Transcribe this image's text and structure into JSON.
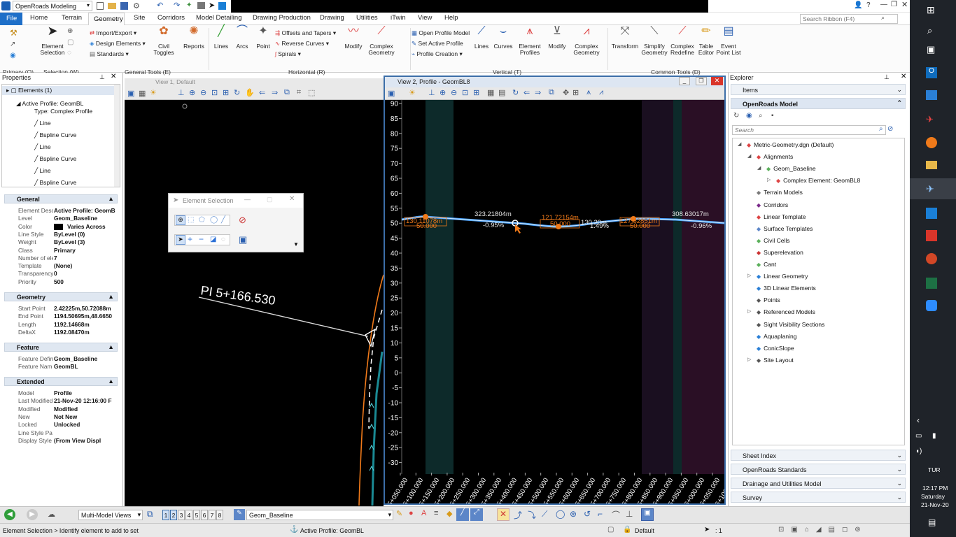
{
  "app": {
    "title_value": "OpenRoads Modeling",
    "search_placeholder": "Search Ribbon (F4)"
  },
  "tabs": [
    "File",
    "Home",
    "Terrain",
    "Geometry",
    "Site",
    "Corridors",
    "Model Detailing",
    "Drawing Production",
    "Drawing",
    "Utilities",
    "iTwin",
    "View",
    "Help"
  ],
  "ribbon": {
    "element_selection": "Element\nSelection",
    "selection_group": "Selection (W)",
    "primary_group": "Primary (Q)",
    "import_export": "Import/Export",
    "design_elements": "Design Elements",
    "standards": "Standards",
    "civil_toggles": "Civil\nToggles",
    "reports": "Reports",
    "general_tools_group": "General Tools (E)",
    "lines": "Lines",
    "arcs": "Arcs",
    "point": "Point",
    "offsets_tapers": "Offsets and Tapers",
    "reverse_curves": "Reverse Curves",
    "spirals": "Spirals",
    "modify": "Modify",
    "complex_geometry": "Complex\nGeometry",
    "horizontal_group": "Horizontal (R)",
    "open_profile_model": "Open Profile Model",
    "set_active_profile": "Set Active Profile",
    "profile_creation": "Profile Creation",
    "v_lines": "Lines",
    "v_curves": "Curves",
    "element_profiles": "Element\nProfiles",
    "v_modify": "Modify",
    "v_complex_geometry": "Complex\nGeometry",
    "vertical_group": "Vertical (T)",
    "transform": "Transform",
    "simplify_geometry": "Simplify\nGeometry",
    "complex_redefine": "Complex\nRedefine",
    "table_editor": "Table\nEditor",
    "event_point_list": "Event\nPoint List",
    "common_tools_group": "Common Tools (D)"
  },
  "properties": {
    "title": "Properties",
    "elements_count": "Elements (1)",
    "active_profile": "Active Profile: GeomBL",
    "type": "Type: Complex Profile",
    "children": [
      "Line",
      "Bspline Curve",
      "Line",
      "Bspline Curve",
      "Line",
      "Bspline Curve"
    ],
    "general_title": "General",
    "general_rows": [
      {
        "k": "Element Desc",
        "v": "Active Profile: GeomB"
      },
      {
        "k": "Level",
        "v": "Geom_Baseline"
      },
      {
        "k": "Color",
        "v": "Varies Across"
      },
      {
        "k": "Line Style",
        "v": "ByLevel (0)"
      },
      {
        "k": "Weight",
        "v": "ByLevel (3)"
      },
      {
        "k": "Class",
        "v": "Primary"
      },
      {
        "k": "Number of ele",
        "v": "7"
      },
      {
        "k": "Template",
        "v": "(None)"
      },
      {
        "k": "Transparency",
        "v": "0"
      },
      {
        "k": "Priority",
        "v": "500"
      }
    ],
    "geometry_title": "Geometry",
    "geometry_rows": [
      {
        "k": "Start Point",
        "v": "2.42225m,50.72088m"
      },
      {
        "k": "End Point",
        "v": "1194.50695m,48.6650"
      },
      {
        "k": "Length",
        "v": "1192.14668m"
      },
      {
        "k": "DeltaX",
        "v": "1192.08470m"
      }
    ],
    "feature_title": "Feature",
    "feature_rows": [
      {
        "k": "Feature Defin",
        "v": "Geom_Baseline"
      },
      {
        "k": "Feature Nam",
        "v": "GeomBL"
      }
    ],
    "extended_title": "Extended",
    "extended_rows": [
      {
        "k": "Model",
        "v": "Profile"
      },
      {
        "k": "Last Modified",
        "v": "21-Nov-20 12:16:00 F"
      },
      {
        "k": "Modified",
        "v": "Modified"
      },
      {
        "k": "New",
        "v": "Not New"
      },
      {
        "k": "Locked",
        "v": "Unlocked"
      },
      {
        "k": "Line Style Pa",
        "v": ""
      },
      {
        "k": "Display Style",
        "v": "(From View Displ"
      }
    ]
  },
  "view1": {
    "title": "View 1, Default",
    "pi_label": "PI 5+166.530"
  },
  "element_selection_dialog": {
    "title": "Element Selection"
  },
  "view2": {
    "title": "View 2, Profile - GeomBL8",
    "y_ticks": [
      "90",
      "85",
      "80",
      "75",
      "70",
      "65",
      "60",
      "55",
      "50",
      "45",
      "40",
      "35",
      "30",
      "25",
      "20",
      "15",
      "10",
      "5",
      "0",
      "-5",
      "-10",
      "-15",
      "-20",
      "-25",
      "-30"
    ],
    "x_ticks": [
      "5+050.000",
      "5+100.000",
      "5+150.000",
      "5+200.000",
      "5+250.000",
      "5+300.000",
      "5+350.000",
      "5+400.000",
      "5+450.000",
      "5+500.000",
      "5+550.000",
      "5+600.000",
      "5+650.000",
      "5+700.000",
      "5+750.000",
      "5+800.000",
      "5+850.000",
      "5+900.000",
      "5+950.000",
      "6+000.000",
      "6+050.000",
      "6+100.000"
    ],
    "annotations": {
      "len1": "323.21804m",
      "grade1": "-0.95%",
      "len2": "121.72154m",
      "len3": "130.20m",
      "grade2": "1.49%",
      "len4": "308.63017m",
      "grade3": "-0.96%",
      "curve_left_len": "130.11078m",
      "curve_left_k": "50.000",
      "curve_mid_k": "50.000",
      "curve_right_len": "127.52851m",
      "curve_right_k": "50.000"
    }
  },
  "explorer": {
    "title": "Explorer",
    "items": "Items",
    "model_title": "OpenRoads Model",
    "search_placeholder": "Search",
    "tree": [
      {
        "label": "Metric-Geometry.dgn (Default)",
        "level": 0
      },
      {
        "label": "Alignments",
        "level": 1
      },
      {
        "label": "Geom_Baseline",
        "level": 2
      },
      {
        "label": "Complex Element: GeomBL8",
        "level": 3
      },
      {
        "label": "Terrain Models",
        "level": 1
      },
      {
        "label": "Corridors",
        "level": 1
      },
      {
        "label": "Linear Template",
        "level": 1
      },
      {
        "label": "Surface Templates",
        "level": 1
      },
      {
        "label": "Civil Cells",
        "level": 1
      },
      {
        "label": "Superelevation",
        "level": 1
      },
      {
        "label": "Cant",
        "level": 1
      },
      {
        "label": "Linear Geometry",
        "level": 1
      },
      {
        "label": "3D Linear Elements",
        "level": 1
      },
      {
        "label": "Points",
        "level": 1
      },
      {
        "label": "Referenced Models",
        "level": 1
      },
      {
        "label": "Sight Visibility Sections",
        "level": 1
      },
      {
        "label": "Aquaplaning",
        "level": 1
      },
      {
        "label": "ConicSlope",
        "level": 1
      },
      {
        "label": "Site Layout",
        "level": 1
      }
    ],
    "sections": [
      "Sheet Index",
      "OpenRoads Standards",
      "Drainage and Utilities Model",
      "Survey"
    ]
  },
  "bottom": {
    "multi_model_views": "Multi-Model Views",
    "views": [
      "1",
      "2",
      "3",
      "4",
      "5",
      "6",
      "7",
      "8"
    ],
    "level_value": "Geom_Baseline"
  },
  "status": {
    "prompt": "Element Selection > Identify element to add to set",
    "active": "Active Profile: GeomBL",
    "model": "Default",
    "count": ": 1"
  },
  "system": {
    "language": "TUR",
    "time": "12:17 PM",
    "day": "Saturday",
    "date": "21-Nov-20"
  },
  "colors": {
    "accent": "#1e6fc8",
    "profile_line": "#4aa3ff",
    "orange": "#f07a1a",
    "teal_band": "#0d2a2a",
    "magenta_band": "#2a0f25"
  }
}
